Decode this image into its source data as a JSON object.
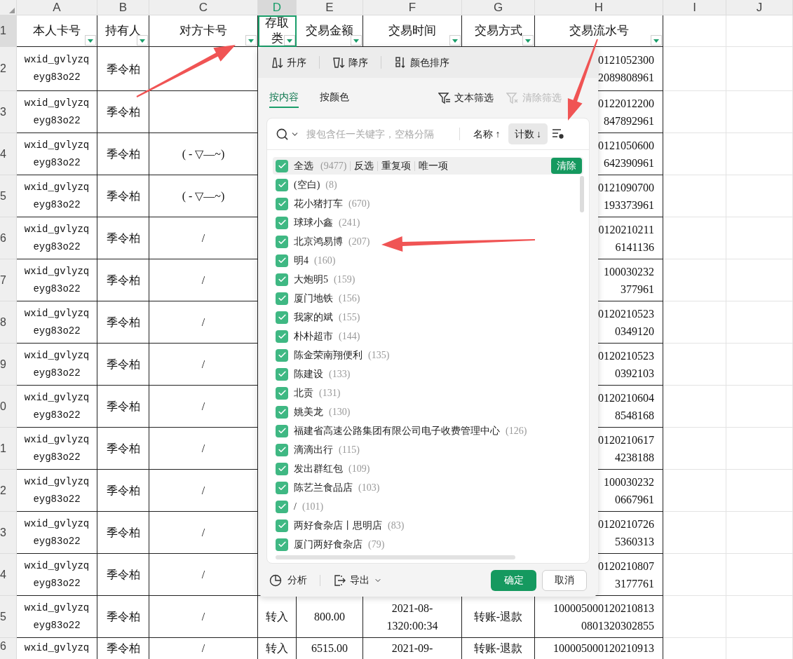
{
  "column_headers": [
    {
      "label": "A",
      "selected": false
    },
    {
      "label": "B",
      "selected": false
    },
    {
      "label": "C",
      "selected": false
    },
    {
      "label": "D",
      "selected": true
    },
    {
      "label": "E",
      "selected": false
    },
    {
      "label": "F",
      "selected": false
    },
    {
      "label": "G",
      "selected": false
    },
    {
      "label": "H",
      "selected": false
    },
    {
      "label": "I",
      "selected": false
    },
    {
      "label": "J",
      "selected": false
    }
  ],
  "row_headers": [
    {
      "label": "1",
      "selected": true
    },
    {
      "label": "2",
      "selected": false
    },
    {
      "label": "3",
      "selected": false
    },
    {
      "label": "4",
      "selected": false
    },
    {
      "label": "5",
      "selected": false
    },
    {
      "label": "6",
      "selected": false
    },
    {
      "label": "7",
      "selected": false
    },
    {
      "label": "8",
      "selected": false
    },
    {
      "label": "9",
      "selected": false
    },
    {
      "label": "0",
      "selected": false
    },
    {
      "label": "1",
      "selected": false
    },
    {
      "label": "2",
      "selected": false
    },
    {
      "label": "3",
      "selected": false
    },
    {
      "label": "4",
      "selected": false
    },
    {
      "label": "5",
      "selected": false
    },
    {
      "label": "6",
      "selected": false
    }
  ],
  "header_cells": [
    {
      "lines": [
        "本人卡号"
      ],
      "filter": true,
      "selected": false
    },
    {
      "lines": [
        "持有人"
      ],
      "filter": true,
      "selected": false
    },
    {
      "lines": [
        "对方卡号"
      ],
      "filter": true,
      "selected": false
    },
    {
      "lines": [
        "存取",
        "类"
      ],
      "filter": true,
      "selected": true
    },
    {
      "lines": [
        "交易金额"
      ],
      "filter": true,
      "selected": false
    },
    {
      "lines": [
        "交易时间"
      ],
      "filter": true,
      "selected": false
    },
    {
      "lines": [
        "交易方式"
      ],
      "filter": true,
      "selected": false
    },
    {
      "lines": [
        "交易流水号"
      ],
      "filter": true,
      "selected": false
    }
  ],
  "rows": [
    {
      "A": [
        "wxid_gvlyzq",
        "eyg83o22"
      ],
      "B": [
        "季令柏"
      ],
      "H": [
        "0121052300",
        "2089808961"
      ]
    },
    {
      "A": [
        "wxid_gvlyzq",
        "eyg83o22"
      ],
      "B": [
        "季令柏"
      ],
      "H": [
        "0122012200",
        "847892961"
      ]
    },
    {
      "A": [
        "wxid_gvlyzq",
        "eyg83o22"
      ],
      "B": [
        "季令柏"
      ],
      "C": [
        "( - ▽—~)"
      ],
      "H": [
        "0121050600",
        "642390961"
      ]
    },
    {
      "A": [
        "wxid_gvlyzq",
        "eyg83o22"
      ],
      "B": [
        "季令柏"
      ],
      "C": [
        "( - ▽—~)"
      ],
      "H": [
        "0121090700",
        "193373961"
      ]
    },
    {
      "A": [
        "wxid_gvlyzq",
        "eyg83o22"
      ],
      "B": [
        "季令柏"
      ],
      "C": [
        "/"
      ],
      "H": [
        "0120210211",
        "6141136"
      ]
    },
    {
      "A": [
        "wxid_gvlyzq",
        "eyg83o22"
      ],
      "B": [
        "季令柏"
      ],
      "C": [
        "/"
      ],
      "H": [
        "100030232",
        "377961"
      ]
    },
    {
      "A": [
        "wxid_gvlyzq",
        "eyg83o22"
      ],
      "B": [
        "季令柏"
      ],
      "C": [
        "/"
      ],
      "H": [
        "0120210523",
        "0349120"
      ]
    },
    {
      "A": [
        "wxid_gvlyzq",
        "eyg83o22"
      ],
      "B": [
        "季令柏"
      ],
      "C": [
        "/"
      ],
      "H": [
        "0120210523",
        "0392103"
      ]
    },
    {
      "A": [
        "wxid_gvlyzq",
        "eyg83o22"
      ],
      "B": [
        "季令柏"
      ],
      "C": [
        "/"
      ],
      "H": [
        "0120210604",
        "8548168"
      ]
    },
    {
      "A": [
        "wxid_gvlyzq",
        "eyg83o22"
      ],
      "B": [
        "季令柏"
      ],
      "C": [
        "/"
      ],
      "H": [
        "0120210617",
        "4238188"
      ]
    },
    {
      "A": [
        "wxid_gvlyzq",
        "eyg83o22"
      ],
      "B": [
        "季令柏"
      ],
      "C": [
        "/"
      ],
      "H": [
        "100030232",
        "0667961"
      ]
    },
    {
      "A": [
        "wxid_gvlyzq",
        "eyg83o22"
      ],
      "B": [
        "季令柏"
      ],
      "C": [
        "/"
      ],
      "H": [
        "0120210726",
        "5360313"
      ]
    },
    {
      "A": [
        "wxid_gvlyzq",
        "eyg83o22"
      ],
      "B": [
        "季令柏"
      ],
      "C": [
        "/"
      ],
      "H": [
        "0120210807",
        "3177761"
      ]
    },
    {
      "A": [
        "wxid_gvlyzq",
        "eyg83o22"
      ],
      "B": [
        "季令柏"
      ],
      "C": [
        "/"
      ],
      "D": [
        "转入"
      ],
      "E": [
        "800.00"
      ],
      "F": [
        "2021-08-",
        "1320:00:34"
      ],
      "G": [
        "转账-退款"
      ],
      "H": [
        "100005000120210813",
        "0801320302855"
      ]
    },
    {
      "A": [
        "wxid_gvlyzq"
      ],
      "B": [
        "季令柏"
      ],
      "C": [
        "/"
      ],
      "D": [
        "转入"
      ],
      "E": [
        "6515.00"
      ],
      "F": [
        "2021-09-"
      ],
      "G": [
        "转账-退款"
      ],
      "H": [
        "100005000120210913"
      ]
    }
  ],
  "filter_panel": {
    "sort_buttons": [
      {
        "kind": "ascending",
        "label": "升序"
      },
      {
        "kind": "descending",
        "label": "降序"
      },
      {
        "kind": "color",
        "label": "颜色排序"
      }
    ],
    "tabs": [
      {
        "label": "按内容",
        "selected": true
      },
      {
        "label": "按颜色",
        "selected": false
      }
    ],
    "actions": [
      {
        "label": "文本筛选",
        "disabled": false
      },
      {
        "label": "清除筛选",
        "disabled": true
      }
    ],
    "search": {
      "placeholder": "搜包含任一关键字，空格分隔"
    },
    "sort_modes": [
      {
        "label": "名称 ↑",
        "selected": false
      },
      {
        "label": "计数 ↓",
        "selected": true
      }
    ],
    "select_all": {
      "label": "全选",
      "count": "(9477)",
      "checked": true
    },
    "quick_links": [
      "反选",
      "重复项",
      "唯一项"
    ],
    "clear_button": "清除",
    "items": [
      {
        "name": "(空白)",
        "count": "(8)",
        "checked": true
      },
      {
        "name": "花小猪打车",
        "count": "(670)",
        "checked": true
      },
      {
        "name": "球球小鑫",
        "count": "(241)",
        "checked": true
      },
      {
        "name": "北京鸿易博",
        "count": "(207)",
        "checked": true
      },
      {
        "name": "明4",
        "count": "(160)",
        "checked": true
      },
      {
        "name": "大炮明5",
        "count": "(159)",
        "checked": true
      },
      {
        "name": "厦门地铁",
        "count": "(156)",
        "checked": true
      },
      {
        "name": "我家的斌",
        "count": "(155)",
        "checked": true
      },
      {
        "name": "朴朴超市",
        "count": "(144)",
        "checked": true
      },
      {
        "name": "陈金荣南翔便利",
        "count": "(135)",
        "checked": true
      },
      {
        "name": "陈建设",
        "count": "(133)",
        "checked": true
      },
      {
        "name": "北贡",
        "count": "(131)",
        "checked": true
      },
      {
        "name": "姚美龙",
        "count": "(130)",
        "checked": true
      },
      {
        "name": "福建省高速公路集团有限公司电子收费管理中心",
        "count": "(126)",
        "checked": true
      },
      {
        "name": "滴滴出行",
        "count": "(115)",
        "checked": true
      },
      {
        "name": "发出群红包",
        "count": "(109)",
        "checked": true
      },
      {
        "name": "陈艺兰食品店",
        "count": "(103)",
        "checked": true
      },
      {
        "name": "/",
        "count": "(101)",
        "checked": true
      },
      {
        "name": "两好食杂店丨思明店",
        "count": "(83)",
        "checked": true
      },
      {
        "name": "厦门两好食杂店",
        "count": "(79)",
        "checked": true
      }
    ],
    "footer": {
      "analyze": "分析",
      "export": "导出",
      "ok": "确定",
      "cancel": "取消"
    }
  }
}
